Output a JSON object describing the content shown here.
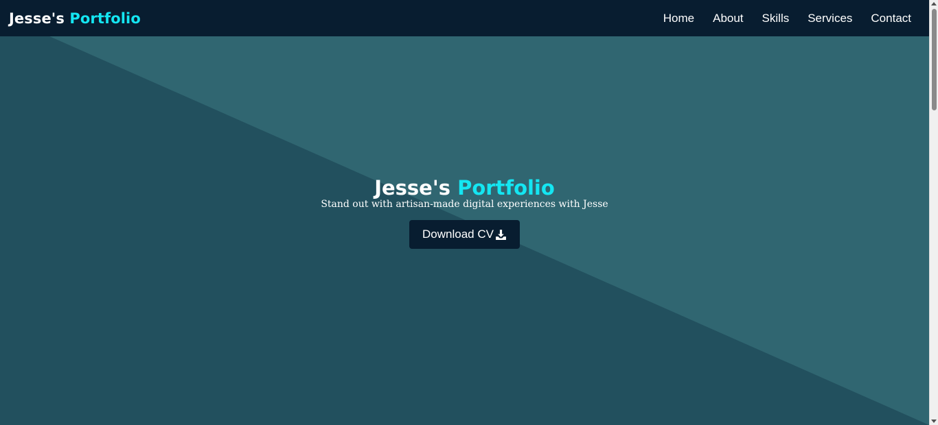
{
  "navbar": {
    "brand_name": "Jesse's",
    "brand_accent": "Portfolio",
    "links": [
      "Home",
      "About",
      "Skills",
      "Services",
      "Contact"
    ]
  },
  "hero": {
    "title_main": "Jesse's",
    "title_accent": "Portfolio",
    "subtitle": "Stand out with artisan-made digital experiences with Jesse",
    "button_label": "Download CV",
    "button_icon": "download-icon"
  },
  "colors": {
    "navbar_bg": "#081d30",
    "accent": "#14e6f2",
    "hero_dark": "#22505e",
    "hero_light": "#306671"
  }
}
